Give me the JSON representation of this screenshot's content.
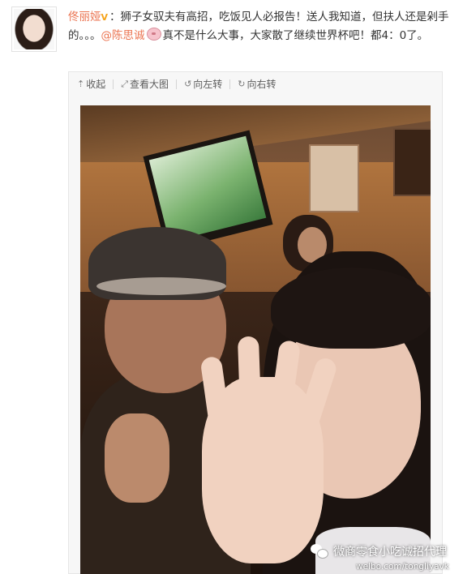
{
  "post": {
    "username": "佟丽娅",
    "text_line1": "：狮子女驭夫有高招，吃饭见人必报告！送人我知道，但扶人还是剁手的。。。",
    "mention": "@陈思诚",
    "text_line2": "真不是什么大事，大家散了继续世界杯吧！都4：0了。"
  },
  "toolbar": {
    "collapse_label": "收起",
    "view_large_label": "查看大图",
    "rotate_left_label": "向左转",
    "rotate_right_label": "向右转"
  },
  "watermark": {
    "text": "微商零食小吃诚招代理",
    "url": "welbo.com/tongliyavk"
  },
  "colors": {
    "username": "#eb7350",
    "vip_badge": "#f5a31a",
    "toolbar_bg": "#f7f7f7",
    "border": "#e6e6e6"
  },
  "icons": [
    "avatar",
    "vip-icon",
    "pig-emoji-icon",
    "collapse-arrow-icon",
    "view-large-icon",
    "rotate-left-icon",
    "rotate-right-icon",
    "wechat-icon"
  ]
}
